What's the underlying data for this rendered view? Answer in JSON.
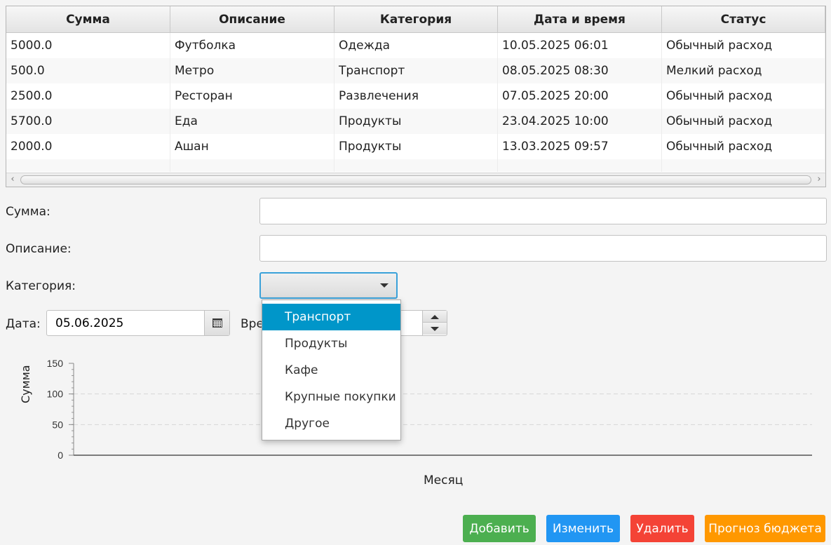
{
  "table": {
    "headers": [
      "Сумма",
      "Описание",
      "Категория",
      "Дата и время",
      "Статус"
    ],
    "rows": [
      [
        "5000.0",
        "Футболка",
        "Одежда",
        "10.05.2025 06:01",
        "Обычный расход"
      ],
      [
        "500.0",
        "Метро",
        "Транспорт",
        "08.05.2025 08:30",
        "Мелкий расход"
      ],
      [
        "2500.0",
        "Ресторан",
        "Развлечения",
        "07.05.2025 20:00",
        "Обычный расход"
      ],
      [
        "5700.0",
        "Еда",
        "Продукты",
        "23.04.2025 10:00",
        "Обычный расход"
      ],
      [
        "2000.0",
        "Ашан",
        "Продукты",
        "13.03.2025 09:57",
        "Обычный расход"
      ]
    ]
  },
  "form": {
    "amount_label": "Сумма:",
    "amount_value": "",
    "description_label": "Описание:",
    "description_value": "",
    "category_label": "Категория:",
    "category_value": "",
    "date_label": "Дата:",
    "date_value": "05.06.2025",
    "time_label": "Вре",
    "calendar_icon": "calendar-icon"
  },
  "category_dropdown": {
    "options": [
      "Транспорт",
      "Продукты",
      "Кафе",
      "Крупные покупки",
      "Другое"
    ],
    "highlighted": "Транспорт"
  },
  "chart_data": {
    "type": "bar",
    "categories": [],
    "series": [],
    "xlabel": "Месяц",
    "ylabel": "Сумма",
    "ylim": [
      0,
      150
    ],
    "yticks": [
      0,
      50,
      100,
      150
    ],
    "grid": true
  },
  "buttons": {
    "add": "Добавить",
    "edit": "Изменить",
    "delete": "Удалить",
    "forecast": "Прогноз бюджета"
  },
  "colors": {
    "add": "#4caf50",
    "edit": "#2196f3",
    "delete": "#f44336",
    "forecast": "#ff9800",
    "selection": "#0096c9",
    "focus": "#3aa1d9"
  }
}
